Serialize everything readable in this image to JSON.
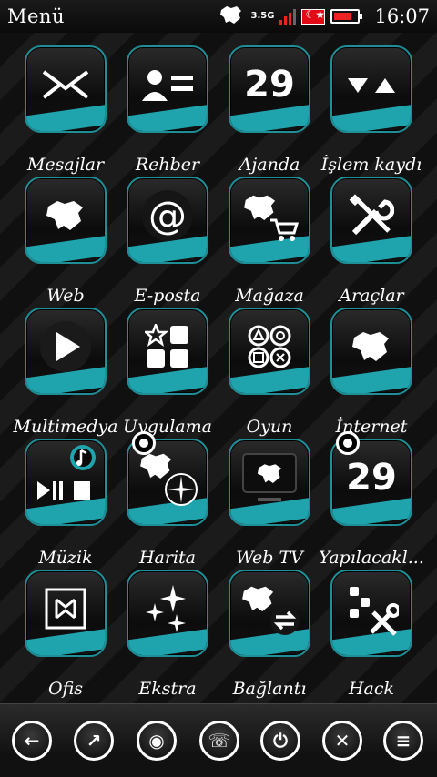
{
  "status": {
    "title": "Menü",
    "network": "3.5G",
    "time": "16:07"
  },
  "accent_color": "#1fa3ac",
  "tiles": [
    {
      "label": "Mesajlar",
      "icon": "envelope-icon"
    },
    {
      "label": "Rehber",
      "icon": "contact-card-icon"
    },
    {
      "label": "Ajanda",
      "icon": "calendar-icon",
      "text": "29"
    },
    {
      "label": "İşlem kaydı",
      "icon": "log-arrows-icon"
    },
    {
      "label": "Web",
      "icon": "world-map-icon"
    },
    {
      "label": "E-posta",
      "icon": "at-sign-icon",
      "text": "@"
    },
    {
      "label": "Mağaza",
      "icon": "store-cart-icon"
    },
    {
      "label": "Araçlar",
      "icon": "tools-icon"
    },
    {
      "label": "Multimedya",
      "icon": "play-icon"
    },
    {
      "label": "Uygulama",
      "icon": "apps-grid-icon"
    },
    {
      "label": "Oyun",
      "icon": "game-buttons-icon"
    },
    {
      "label": "İnternet",
      "icon": "world-map-icon"
    },
    {
      "label": "Müzik",
      "icon": "music-player-icon"
    },
    {
      "label": "Harita",
      "icon": "map-compass-icon"
    },
    {
      "label": "Web TV",
      "icon": "tv-icon"
    },
    {
      "label": "Yapılacakl...",
      "icon": "calendar-icon",
      "text": "29"
    },
    {
      "label": "Ofis",
      "icon": "office-frame-icon"
    },
    {
      "label": "Ekstra",
      "icon": "sparkle-icon"
    },
    {
      "label": "Bağlantı",
      "icon": "connectivity-icon"
    },
    {
      "label": "Hack",
      "icon": "apps-tools-icon"
    }
  ],
  "dock": [
    {
      "name": "back-icon",
      "glyph": "←"
    },
    {
      "name": "external-icon",
      "glyph": "↗"
    },
    {
      "name": "globe-icon",
      "glyph": "◉"
    },
    {
      "name": "phone-icon",
      "glyph": "☏"
    },
    {
      "name": "power-icon",
      "glyph": "⏻"
    },
    {
      "name": "close-icon",
      "glyph": "✕"
    },
    {
      "name": "menu-icon",
      "glyph": "≡"
    }
  ]
}
